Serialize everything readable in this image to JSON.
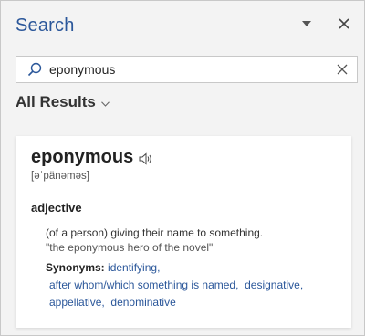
{
  "pane": {
    "title": "Search",
    "dropdown_icon": "caret-down-icon",
    "close_icon": "close-icon"
  },
  "search": {
    "value": "eponymous",
    "placeholder": "",
    "icon": "search-icon",
    "clear_icon": "clear-icon"
  },
  "results": {
    "filter_label": "All Results",
    "chevron": "chevron-down-icon"
  },
  "entry": {
    "word": "eponymous",
    "speaker_icon": "speaker-icon",
    "pronunciation": "[əˈpänəməs]",
    "part_of_speech": "adjective",
    "definition": "(of a person) giving their name to something.",
    "example": "\"the eponymous hero of the novel\"",
    "synonyms_label": "Synonyms:",
    "synonyms": [
      "identifying,",
      "after whom/which something is named,",
      "designative,",
      "appellative,",
      "denominative"
    ]
  },
  "colors": {
    "accent": "#2b579a",
    "pane_bg": "#f3f3f3",
    "card_bg": "#ffffff"
  }
}
